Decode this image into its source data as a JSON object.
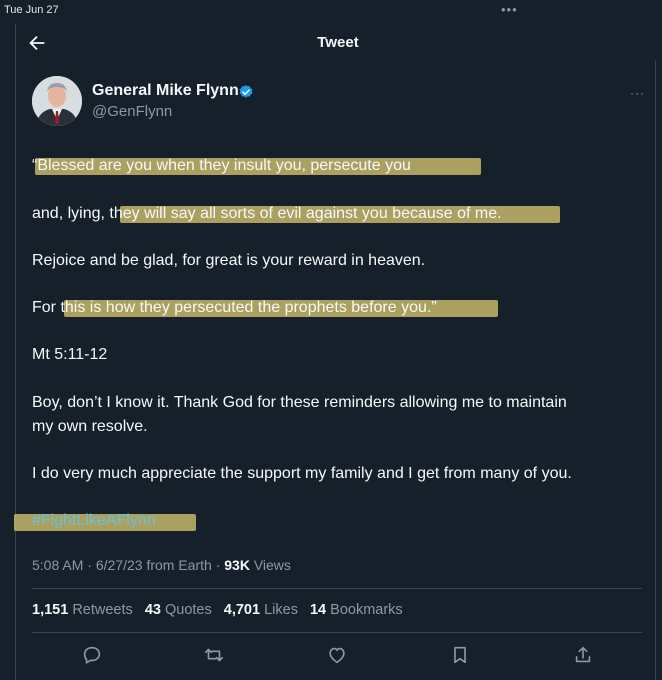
{
  "status_bar": {
    "time": "Tue Jun 27",
    "dots": "•••"
  },
  "header": {
    "title": "Tweet",
    "back_icon": "arrow-left-icon"
  },
  "author": {
    "name": "General Mike Flynn",
    "handle": "@GenFlynn",
    "verified_icon": "verified-badge-icon"
  },
  "more_menu": "···",
  "tweet": {
    "line1": "“Blessed are you when they insult you, persecute you",
    "line2": "and, lying, they will say all sorts of evil against you because of me.",
    "line3": "Rejoice and be glad, for great is your reward in heaven.",
    "line4": "For this is how they persecuted the prophets before you.”",
    "line5": "Mt 5:11-12",
    "line6": "Boy, don’t I know it. Thank God for these reminders allowing me to maintain",
    "line7": "my own resolve.",
    "line8": "I do very much appreciate the support my family and I get from many of you.",
    "hashtag": "#FightLikeAFlynn"
  },
  "meta": {
    "time": "5:08 AM",
    "date": "6/27/23",
    "source": "from Earth",
    "views_count": "93K",
    "views_label": "Views",
    "sep": "·"
  },
  "stats": {
    "retweets": {
      "count": "1,151",
      "label": "Retweets"
    },
    "quotes": {
      "count": "43",
      "label": "Quotes"
    },
    "likes": {
      "count": "4,701",
      "label": "Likes"
    },
    "bookmarks": {
      "count": "14",
      "label": "Bookmarks"
    }
  },
  "colors": {
    "background": "#15202b",
    "text": "#f7f9f9",
    "muted": "#8b98a5",
    "highlight": "#d6c470",
    "verified": "#1d9bf0"
  }
}
